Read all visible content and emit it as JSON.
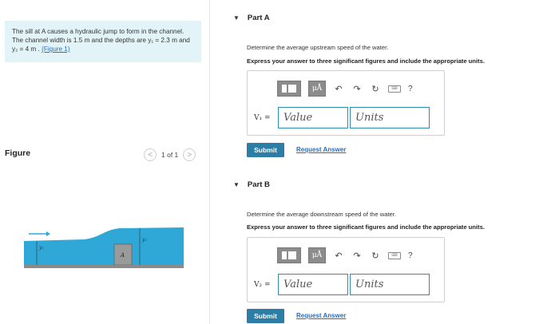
{
  "problem": {
    "text": "The sill at A causes a hydraulic jump to form in the channel. The channel width is 1.5 m and the depths are y₁ = 2.3 m and y₂ = 4 m .",
    "figure_link": "(Figure 1)"
  },
  "figure": {
    "title": "Figure",
    "pager_text": "1 of 1",
    "prev": "<",
    "next": ">",
    "label_y1": "y₁",
    "label_y2": "y₂",
    "label_a": "A",
    "water_color": "#2fa8d8",
    "ground_color": "#8a8a8a"
  },
  "partA": {
    "caret": "▼",
    "title": "Part A",
    "question": "Determine the average upstream speed of the water.",
    "instruction": "Express your answer to three significant figures and include the appropriate units.",
    "mu_label": "μÅ",
    "help": "?",
    "var_label": "V₁ =",
    "value_placeholder": "Value",
    "units_placeholder": "Units",
    "submit": "Submit",
    "request": "Request Answer"
  },
  "partB": {
    "caret": "▼",
    "title": "Part B",
    "question": "Determine the average downstream speed of the water.",
    "instruction": "Express your answer to three significant figures and include the appropriate units.",
    "mu_label": "μÅ",
    "help": "?",
    "var_label": "V₂ =",
    "value_placeholder": "Value",
    "units_placeholder": "Units",
    "submit": "Submit",
    "request": "Request Answer"
  },
  "colors": {
    "accent": "#2c7ea7",
    "link": "#2a6ebb",
    "problem_bg": "#e3f4f8",
    "field_border": "#2c8db6"
  }
}
